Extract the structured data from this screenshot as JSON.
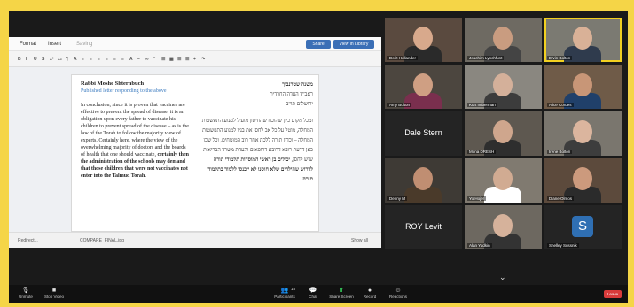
{
  "editor": {
    "menu": [
      "Format",
      "Insert",
      "Saving"
    ],
    "share_label": "Share",
    "library_label": "View in Library",
    "toolbar": [
      "B",
      "I",
      "U",
      "S",
      "x²",
      "x₂",
      "¶",
      "A",
      "≡",
      "≡",
      "≡",
      "≡",
      "≡",
      "≡",
      "A",
      "−",
      "∞",
      "“",
      "☰",
      "▦",
      "☰",
      "☰",
      "+",
      "↷"
    ],
    "english": {
      "author": "Rabbi Moshe Shternbuch",
      "subtitle": "Published letter responding to the above",
      "body": "In conclusion, since it is proven that vaccines are effective to prevent the spread of disease, it is an obligation upon every father to vaccinate his children to prevent spread of the disease – as is the law of the Torah to follow the majority view of experts. Certainly here, where the view of the overwhelming majority of doctors and the boards of health that one should vaccinate,",
      "body_bold": "certainly then the administration of the schools may demand that those children that were not vaccinates not enter into the Talmud Torah."
    },
    "hebrew": {
      "heading": "משנה שטרנבוך",
      "line2": "ראב\"ד העדה החרדית",
      "line3": "ירושלים תו\"ב",
      "body": "ומכל מקום כיון שהוכח שהחיסון מועיל למנוע התפשטות המחלה, מוטל על כל אב לחסן את בניו למנוע התפשטות המחלה – וכדין תורה ללכת אחר רוב המומחים, וכל שכן כאן דדעת רובא דרובא דרופאים והעדת משרד הבריאות שיש לחסן,",
      "body_bold": "יכולים בן ראשי המוסדות תלמודי תורה לדרוש שהילדים שלא חוסנו לא ייכנסו ללמוד בתלמוד תורה."
    },
    "status_left": "Redirect...",
    "status_mid": "COMPARE_FINAL.jpg",
    "status_right": "Show all"
  },
  "participants": [
    {
      "name": "Dorit Hollander",
      "bg": "#5a4a3f",
      "skin": "#d8a98c",
      "shirt": "#2a2a2a"
    },
    {
      "name": "Joachim Lynchfunt",
      "bg": "#6e6a62",
      "skin": "#c99c80",
      "shirt": "#444"
    },
    {
      "name": "Ervin Bolton",
      "bg": "#7b7a72",
      "skin": "#d9b197",
      "shirt": "#2f3b4d"
    },
    {
      "name": "Amy Bolton",
      "bg": "#4c463f",
      "skin": "#cf9f83",
      "shirt": "#7a2f4e"
    },
    {
      "name": "Kurt Imberman",
      "bg": "#8a8780",
      "skin": "#d4b09a",
      "shirt": "#3c3c3c"
    },
    {
      "name": "Alice Cordes",
      "bg": "#6f5b48",
      "skin": "#c89677",
      "shirt": "#20406a"
    },
    {
      "name": "Dale Stern",
      "video": false
    },
    {
      "name": "Mona DRESH",
      "bg": "#5e5850",
      "skin": "#cfa68d",
      "shirt": "#2e2e2e"
    },
    {
      "name": "Irene Bolton",
      "bg": "#7a766e",
      "skin": "#dbb59e",
      "shirt": "#3d3d3d"
    },
    {
      "name": "Denny M",
      "bg": "#3e3a35",
      "skin": "#c08e72",
      "shirt": "#4a3a2a"
    },
    {
      "name": "Yo Hojer",
      "bg": "#807a70",
      "skin": "#d1ab92",
      "shirt": "#ffffff"
    },
    {
      "name": "Diane Olmos",
      "bg": "#5c4a3c",
      "skin": "#cc9a7d",
      "shirt": "#2b2b2b"
    },
    {
      "name": "ROY Levit",
      "video": false
    },
    {
      "name": "Alan Yudkin",
      "bg": "#6d6860",
      "skin": "#d6b29b",
      "shirt": "#333"
    },
    {
      "name": "Shelley Sussnik",
      "video": false,
      "initial": "S"
    }
  ],
  "zoombar": {
    "left": [
      {
        "icon": "🎙",
        "label": "Unmute"
      },
      {
        "icon": "■",
        "label": "Stop Video"
      }
    ],
    "center": [
      {
        "icon": "👥",
        "label": "Participants"
      },
      {
        "icon": "💬",
        "label": "Chat"
      },
      {
        "icon": "⬆",
        "label": "Share Screen"
      },
      {
        "icon": "●",
        "label": "Record"
      },
      {
        "icon": "☺",
        "label": "Reactions"
      }
    ],
    "participant_count": "15",
    "leave_label": "Leave"
  },
  "colors": {
    "frame": "#f5d547",
    "active_speaker": "#f2d021",
    "share_green": "#34c759",
    "leave_red": "#d93b3b"
  }
}
